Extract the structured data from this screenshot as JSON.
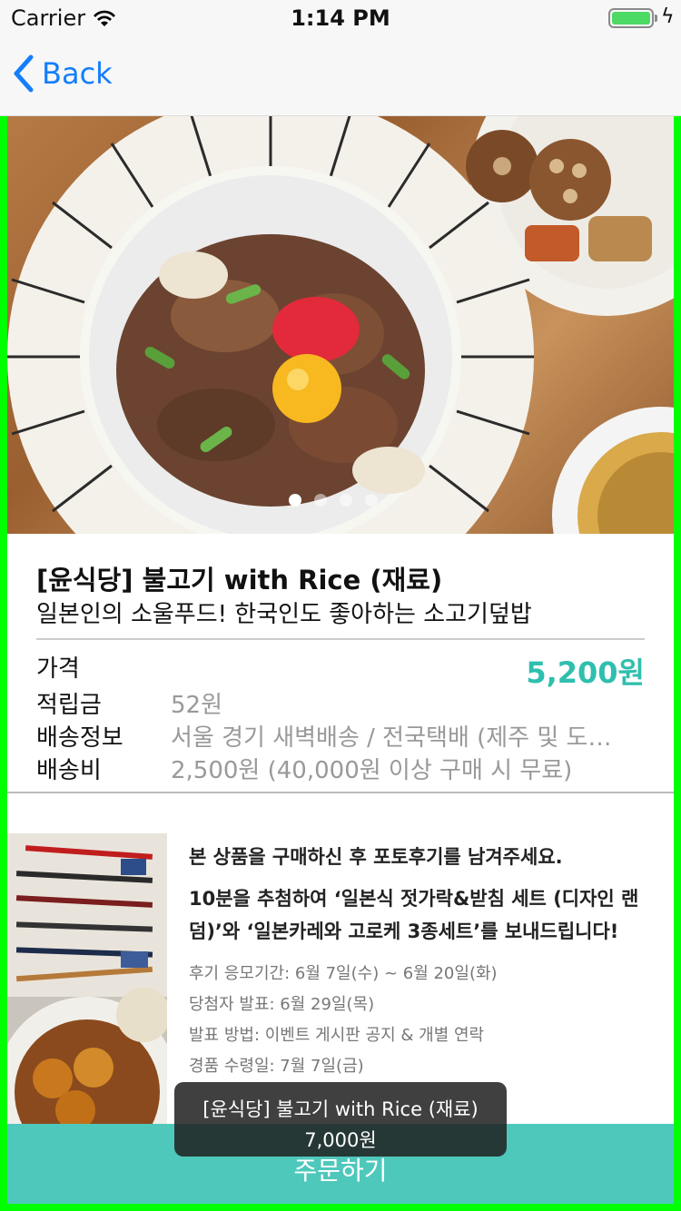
{
  "status_bar": {
    "carrier": "Carrier",
    "time": "1:14 PM"
  },
  "nav": {
    "back_label": "Back"
  },
  "hero": {
    "page_count": 4,
    "active_page": 1
  },
  "product": {
    "title": "[윤식당] 불고기 with Rice (재료)",
    "subtitle": "일본인의 소울푸드! 한국인도 좋아하는 소고기덮밥",
    "price_label": "가격",
    "price_value": "5,200원",
    "points_label": "적립금",
    "points_value": "52원",
    "delivery_label": "배송정보",
    "delivery_value": "서울 경기 새벽배송 / 전국택배 (제주 및 도…",
    "shipping_label": "배송비",
    "shipping_value": "2,500원 (40,000원 이상 구매 시 무료)"
  },
  "promo": {
    "line1": "본 상품을 구매하신 후 포토후기를 남겨주세요.",
    "line2": "10분을 추첨하여 ‘일본식 젓가락&받침 세트 (디자인 랜덤)’와 ‘일본카레와 고로케 3종세트’를 보내드립니다!",
    "detail1": "후기 응모기간: 6월 7일(수) ~ 6월 20일(화)",
    "detail2": "당첨자 발표: 6월 29일(목)",
    "detail3": "발표 방법: 이벤트 게시판 공지 & 개별 연락",
    "detail4": "경품 수령일: 7월 7일(금)"
  },
  "order_button": {
    "label": "주문하기"
  },
  "toast": {
    "name": "[윤식당] 불고기 with Rice (재료)",
    "price": "7,000원"
  },
  "colors": {
    "accent": "#2fbfae",
    "order_button": "#4fc8bc",
    "nav_tint": "#147efb",
    "frame": "#00ff00"
  }
}
